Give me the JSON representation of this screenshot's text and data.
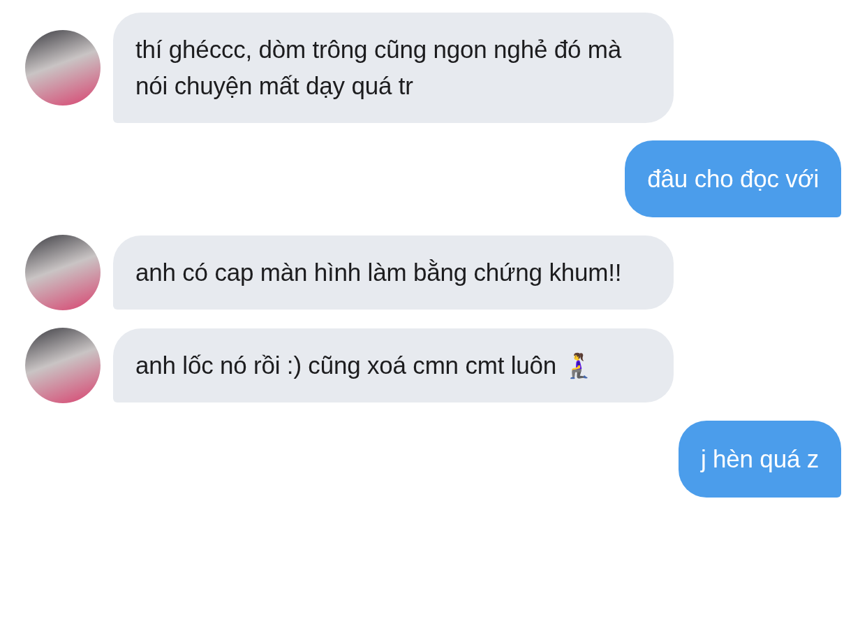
{
  "messages": [
    {
      "kind": "incoming",
      "text": "thí ghéccc, dòm trông cũng ngon nghẻ đó mà nói chuyện mất dạy quá tr"
    },
    {
      "kind": "outgoing",
      "text": "đâu cho đọc với"
    },
    {
      "kind": "incoming",
      "text": "anh có cap màn hình làm bằng chứng khum!!"
    },
    {
      "kind": "incoming",
      "text": "anh lốc nó rồi :) cũng xoá cmn cmt luôn 🧎‍♀️"
    },
    {
      "kind": "outgoing",
      "text": "j hèn quá z"
    }
  ]
}
